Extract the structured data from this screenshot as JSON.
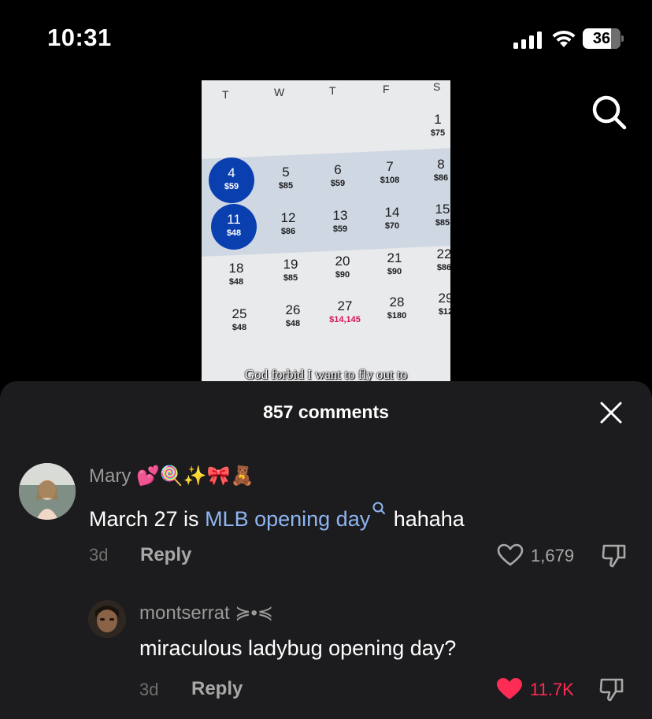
{
  "status_bar": {
    "time": "10:31",
    "battery": "36"
  },
  "video": {
    "weekdays": [
      "T",
      "W",
      "T",
      "F",
      "S"
    ],
    "days": [
      {
        "num": "1",
        "price": "$75"
      },
      {
        "num": "4",
        "price": "$59"
      },
      {
        "num": "5",
        "price": "$85"
      },
      {
        "num": "6",
        "price": "$59"
      },
      {
        "num": "7",
        "price": "$108"
      },
      {
        "num": "8",
        "price": "$86"
      },
      {
        "num": "11",
        "price": "$48"
      },
      {
        "num": "12",
        "price": "$86"
      },
      {
        "num": "13",
        "price": "$59"
      },
      {
        "num": "14",
        "price": "$70"
      },
      {
        "num": "15",
        "price": "$85"
      },
      {
        "num": "18",
        "price": "$48"
      },
      {
        "num": "19",
        "price": "$85"
      },
      {
        "num": "20",
        "price": "$90"
      },
      {
        "num": "21",
        "price": "$90"
      },
      {
        "num": "22",
        "price": "$86"
      },
      {
        "num": "25",
        "price": "$48"
      },
      {
        "num": "26",
        "price": "$48"
      },
      {
        "num": "27",
        "price": "$14,145"
      },
      {
        "num": "28",
        "price": "$180"
      },
      {
        "num": "29",
        "price": "$12"
      }
    ],
    "caption": "God forbid I want to fly out to"
  },
  "comments_sheet": {
    "title": "857 comments",
    "comments": [
      {
        "username": "Mary 💕🍭✨🎀🧸",
        "text_before": "March 27 is ",
        "link": "MLB opening day",
        "text_after": " hahaha",
        "time": "3d",
        "reply_label": "Reply",
        "likes": "1,679",
        "liked": false
      },
      {
        "username": "montserrat ≽•≼",
        "text": "miraculous ladybug opening day?",
        "time": "3d",
        "reply_label": "Reply",
        "likes": "11.7K",
        "liked": true,
        "like_color": "#fe2c55"
      }
    ]
  }
}
